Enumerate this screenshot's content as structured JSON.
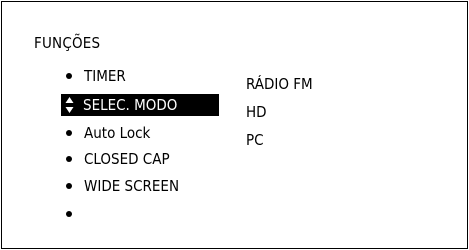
{
  "menu": {
    "title": "FUNÇÕES",
    "items": [
      {
        "label": "TIMER"
      },
      {
        "label": "SELEC. MODO"
      },
      {
        "label": "Auto Lock"
      },
      {
        "label": "CLOSED CAP"
      },
      {
        "label": "WIDE SCREEN"
      },
      {
        "label": ""
      }
    ],
    "selected_index": 1
  },
  "options": {
    "items": [
      {
        "label": "RÁDIO FM"
      },
      {
        "label": "HD"
      },
      {
        "label": "PC"
      }
    ]
  },
  "colors": {
    "background": "#ffffff",
    "text": "#000000",
    "highlight_bg": "#000000",
    "highlight_text": "#ffffff"
  },
  "icons": {
    "bullet": "bullet-dot-icon",
    "selector": "up-down-arrows-icon"
  }
}
